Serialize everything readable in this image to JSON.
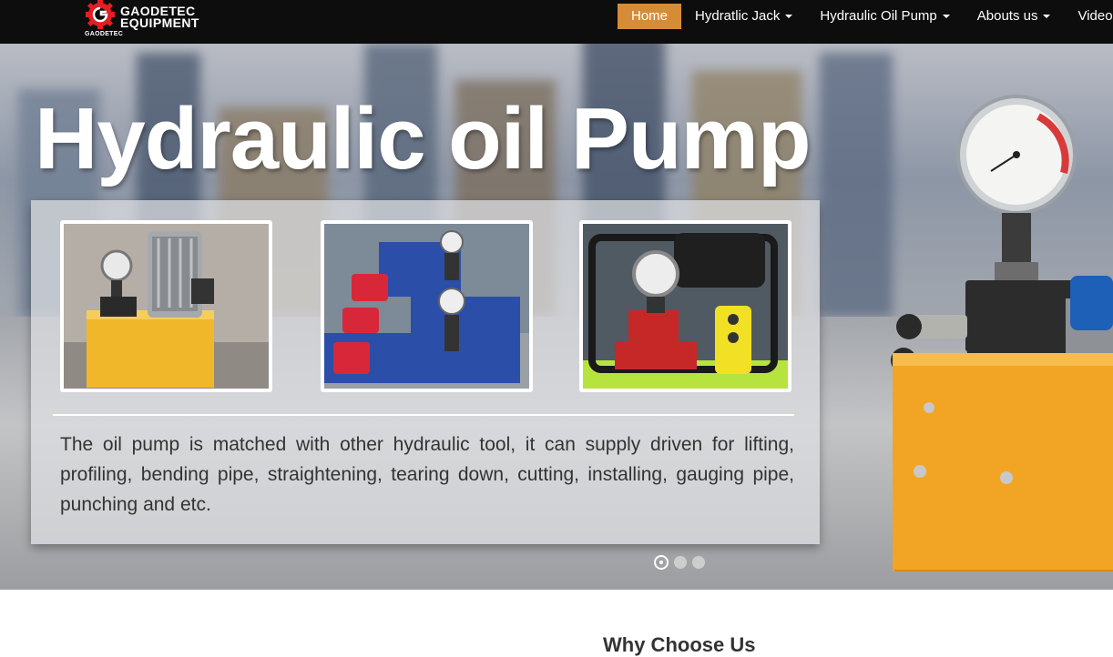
{
  "brand": {
    "name_line1": "GAODETEC",
    "name_line2": "EQUIPMENT",
    "sub": "GAODETEC",
    "icon": "gear-g-logo-icon",
    "accent": "#d68c37",
    "logo_red": "#e31e24"
  },
  "nav": {
    "items": [
      {
        "label": "Home",
        "active": true
      },
      {
        "label": "Hydratlic Jack",
        "dropdown": true
      },
      {
        "label": "Hydraulic Oil Pump",
        "dropdown": true
      },
      {
        "label": "Abouts us",
        "dropdown": true
      },
      {
        "label": "Video"
      }
    ]
  },
  "hero": {
    "title": "Hydraulic oil Pump",
    "description": "The oil pump is matched with other hydraulic tool, it can supply driven for lifting, profiling, bending pipe, straightening, tearing down, cutting, installing, gauging pipe, punching and etc.",
    "thumbnails": [
      {
        "name": "yellow-electric-pump-photo"
      },
      {
        "name": "blue-gasoline-pumps-photo"
      },
      {
        "name": "black-electric-pump-with-pendant-photo"
      }
    ],
    "carousel": {
      "slides": 3,
      "active_index": 0
    }
  },
  "section": {
    "heading_partial": "Why Choose Us"
  }
}
